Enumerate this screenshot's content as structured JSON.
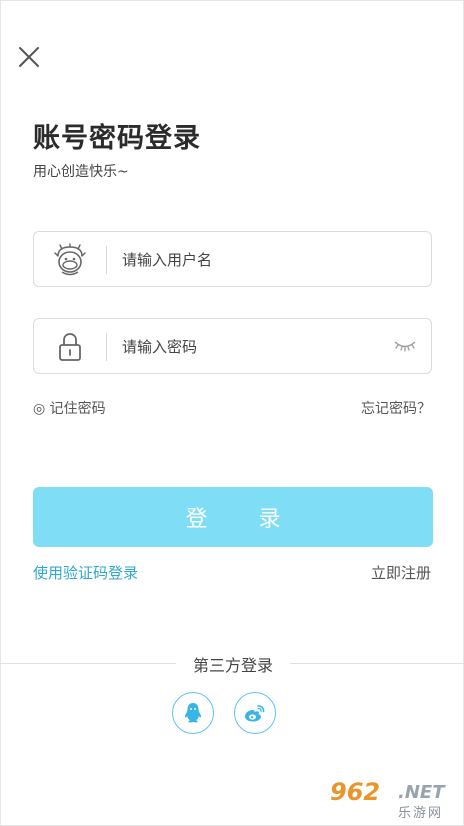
{
  "header": {
    "title": "账号密码登录",
    "subtitle": "用心创造快乐~"
  },
  "form": {
    "username_placeholder": "请输入用户名",
    "password_placeholder": "请输入密码",
    "remember_label": "◎ 记住密码",
    "forgot_label": "忘记密码？",
    "login_button": "登 录"
  },
  "links": {
    "sms_login": "使用验证码登录",
    "register": "立即注册"
  },
  "third_party": {
    "title": "第三方登录",
    "providers": [
      "qq-icon",
      "weibo-icon"
    ]
  },
  "watermark": {
    "main": "962",
    "net": ".NET",
    "sub": "乐游网"
  },
  "colors": {
    "accent": "#7fdef6",
    "link": "#2fa8cf",
    "social_border": "#5fc4eb"
  }
}
